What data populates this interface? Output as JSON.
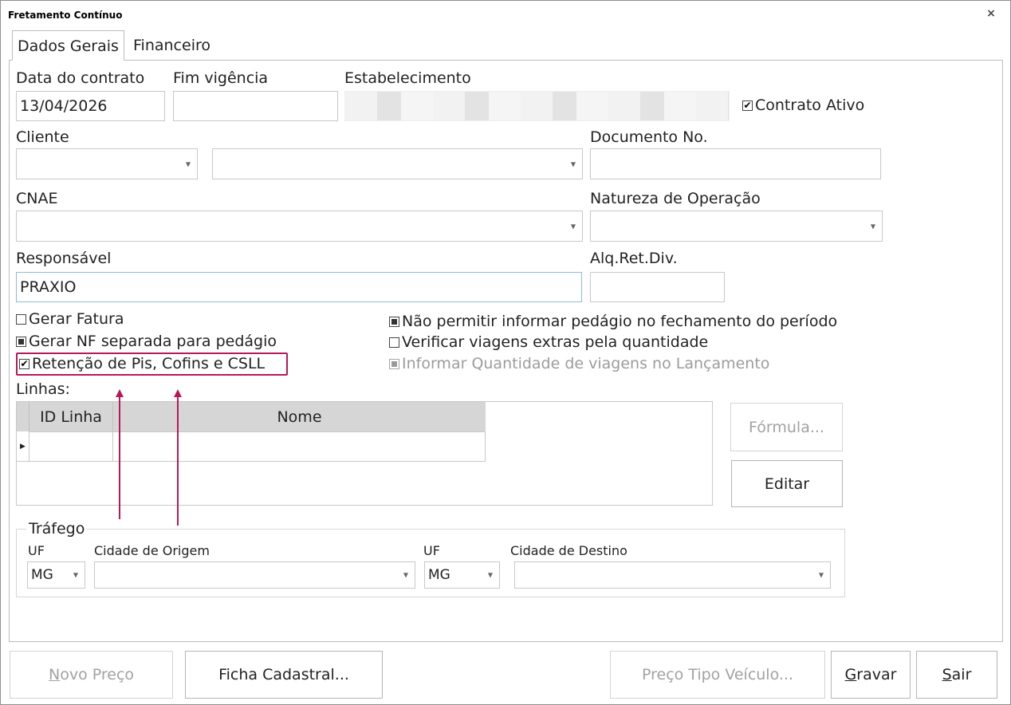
{
  "window": {
    "title": "Fretamento Contínuo",
    "close": "×"
  },
  "tabs": [
    {
      "label": "Dados Gerais"
    },
    {
      "label": "Financeiro"
    }
  ],
  "form": {
    "data_contrato_label": "Data do contrato",
    "data_contrato_value": "13/04/2026",
    "fim_vigencia_label": "Fim vigência",
    "fim_vigencia_value": "",
    "estabelecimento_label": "Estabelecimento",
    "contrato_ativo_label": "Contrato Ativo",
    "cliente_label": "Cliente",
    "documento_label": "Documento No.",
    "cnae_label": "CNAE",
    "natureza_label": "Natureza de Operação",
    "responsavel_label": "Responsável",
    "responsavel_value": "PRAXIO",
    "aliq_label": "Alq.Ret.Div."
  },
  "checks": {
    "gerar_fatura": "Gerar Fatura",
    "gerar_nf": "Gerar NF separada para pedágio",
    "retencao": "Retenção de Pis, Cofins e CSLL",
    "nao_permitir": "Não permitir informar pedágio no fechamento do período",
    "verificar": "Verificar viagens extras pela quantidade",
    "informar": "Informar Quantidade de viagens no Lançamento"
  },
  "linhas": {
    "label": "Linhas:",
    "columns": [
      "ID Linha",
      "Nome"
    ]
  },
  "side_buttons": {
    "formula": "Fórmula...",
    "editar": "Editar"
  },
  "trafego": {
    "title": "Tráfego",
    "uf_label": "UF",
    "origem_label": "Cidade de Origem",
    "uf2_label": "UF",
    "destino_label": "Cidade de Destino",
    "uf_value": "MG",
    "uf2_value": "MG"
  },
  "footer": {
    "novo_preco_u": "N",
    "novo_preco_rest": "ovo Preço",
    "ficha": "Ficha Cadastral...",
    "preco_tipo": "Preço Tipo Veículo...",
    "gravar_u": "G",
    "gravar_rest": "ravar",
    "sair_u": "S",
    "sair_rest": "air"
  },
  "colors": {
    "accent_annotation": "#b8185a",
    "focus_border": "#8fb8df"
  }
}
